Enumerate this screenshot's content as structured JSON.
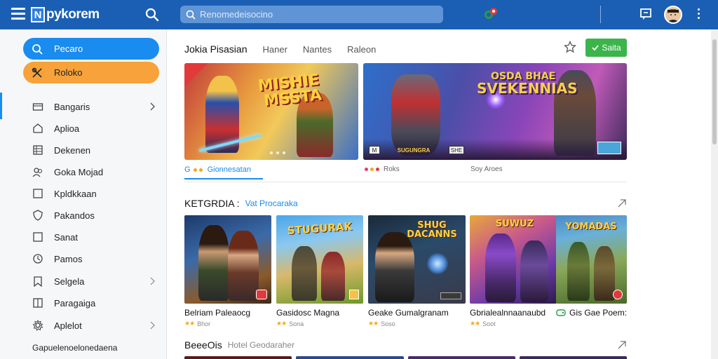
{
  "app": {
    "logo_letter": "N",
    "logo_text": "pykorem"
  },
  "search": {
    "placeholder": "Renomedeisocino"
  },
  "sidebar": {
    "pills": [
      {
        "label": "Pecaro",
        "icon": "search-icon"
      },
      {
        "label": "Roloko",
        "icon": "tools-icon"
      }
    ],
    "items": [
      {
        "label": "Bangaris",
        "icon": "folder-icon",
        "chevron": true
      },
      {
        "label": "Aplioa",
        "icon": "home-icon",
        "chevron": false
      },
      {
        "label": "Dekenen",
        "icon": "grid-icon",
        "chevron": false
      },
      {
        "label": "Goka Mojad",
        "icon": "user-group-icon",
        "chevron": false
      },
      {
        "label": "Kpldkkaan",
        "icon": "square-icon",
        "chevron": false
      },
      {
        "label": "Pakandos",
        "icon": "shield-icon",
        "chevron": false
      },
      {
        "label": "Sanat",
        "icon": "square-icon",
        "chevron": false
      },
      {
        "label": "Pamos",
        "icon": "clock-icon",
        "chevron": false
      },
      {
        "label": "Selgela",
        "icon": "bookmark-icon",
        "chevron": true
      },
      {
        "label": "Paragaiga",
        "icon": "book-icon",
        "chevron": false
      },
      {
        "label": "Aplelot",
        "icon": "gear-icon",
        "chevron": true
      },
      {
        "label": "Gapuelenoelonedaena",
        "icon": "",
        "chevron": false
      }
    ]
  },
  "main": {
    "tabs": [
      "Jokia Pisasian",
      "Haner",
      "Nantes",
      "Raleon"
    ],
    "subscribe_label": "Saita",
    "banners": [
      {
        "title_line1": "MISHIE",
        "title_line2": "MSSTA"
      },
      {
        "title_line1": "OSDA BHAE",
        "title_line2": "SVEKENNIAS",
        "badge_left": "M",
        "badge_mid": "SUGUNGRA",
        "badge_right": "SHE"
      }
    ],
    "banner_captions": [
      "Gionnesatan",
      "Roks",
      "Soy Aroes"
    ],
    "section1": {
      "title": "KETGRDIA :",
      "subtitle": "Vat Procaraka"
    },
    "cards": [
      {
        "title": "Belriam Paleaocg",
        "meta": "Bhor",
        "art": "",
        "stars": "★★"
      },
      {
        "title": "Gasidosc Magna",
        "meta": "Sona",
        "art": "STUGURAK",
        "stars": "★★"
      },
      {
        "title": "Geake Gumalgranam",
        "meta": "Soso",
        "art": "SHUG DACANNS",
        "stars": "★★"
      },
      {
        "title": "Gbrialealnnaanaubd",
        "meta": "Soot",
        "art": "SUWUZ",
        "stars": "★★"
      },
      {
        "title": "Gis Gae Poem:",
        "meta": "",
        "art": "YOMADAS",
        "stars": ""
      }
    ],
    "section2": {
      "title": "BeeeOis",
      "subtitle": "Hotel Geodaraher"
    }
  },
  "colors": {
    "topbar": "#1a5fb4",
    "accent_blue": "#1a8cf0",
    "accent_orange": "#f7a23a",
    "subscribe_green": "#3cb44b"
  }
}
